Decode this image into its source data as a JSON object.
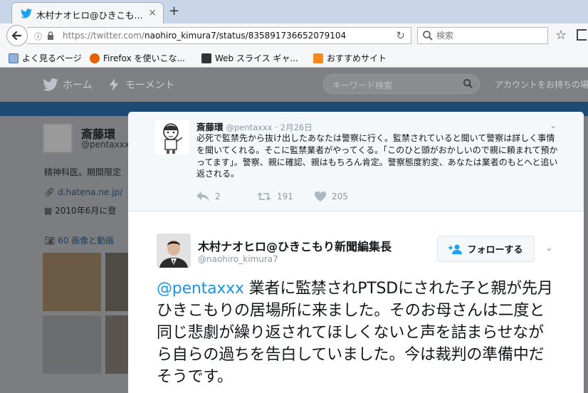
{
  "browser": {
    "tab": {
      "title": "木村ナオヒロ@ひきこも...",
      "close": "×"
    },
    "new_tab": "+",
    "url": {
      "prefix": "https://twitter.com/",
      "path": "naohiro_kimura7/status/835891736652079104"
    },
    "search_placeholder": "検索",
    "bookmarks": [
      {
        "label": "よく見るページ",
        "icon": "bookmark-folder-icon"
      },
      {
        "label": "Firefox を使いこな...",
        "icon": "firefox-icon"
      },
      {
        "label": "Web スライス ギャ...",
        "icon": "web-slice-icon"
      },
      {
        "label": "おすすめサイト",
        "icon": "suggested-sites-icon"
      }
    ]
  },
  "twitter_nav": {
    "home": "ホーム",
    "moments": "モーメント",
    "search_placeholder": "キーワード検索",
    "account": "アカウントをお持ちの場"
  },
  "profile": {
    "name": "斎藤環",
    "handle": "@pentaxxx",
    "bio": "精神科医。期間限定",
    "link": "d.hatena.ne.jp/",
    "joined": "2010年6月に登",
    "media": "60 画像と動画"
  },
  "ancestor_tweet": {
    "name": "斎藤環",
    "handle": "@pentaxxx",
    "dot": "·",
    "date": "2月26日",
    "text": "必死で監禁先から抜け出したあなたは警察に行く。監禁されていると聞いて警察は詳しく事情を聞いてくれる。そこに監禁業者がやってくる。「このひと頭がおかしいので親に頼まれて預かってます」。警察、親に確認、親はもちろん肯定。警察態度豹変、あなたは業者のもとへと追い返される。",
    "replies": "2",
    "retweets": "191",
    "likes": "205"
  },
  "main_tweet": {
    "name": "木村ナオヒロ@ひきこもり新聞編集長",
    "handle": "@naohiro_kimura7",
    "follow_label": "フォローする",
    "mention": "@pentaxxx",
    "text": " 業者に監禁されPTSDにされた子と親が先月ひきこもりの居場所に来ました。そのお母さんは二度と同じ悲劇が繰り返されてほしくないと声を詰まらせながら自らの過ちを告白していました。今は裁判の準備中だそうです。"
  },
  "colors": {
    "twitter_blue": "#1da1f2",
    "link_blue": "#1b95e0",
    "overlay": "#7b7d80"
  }
}
